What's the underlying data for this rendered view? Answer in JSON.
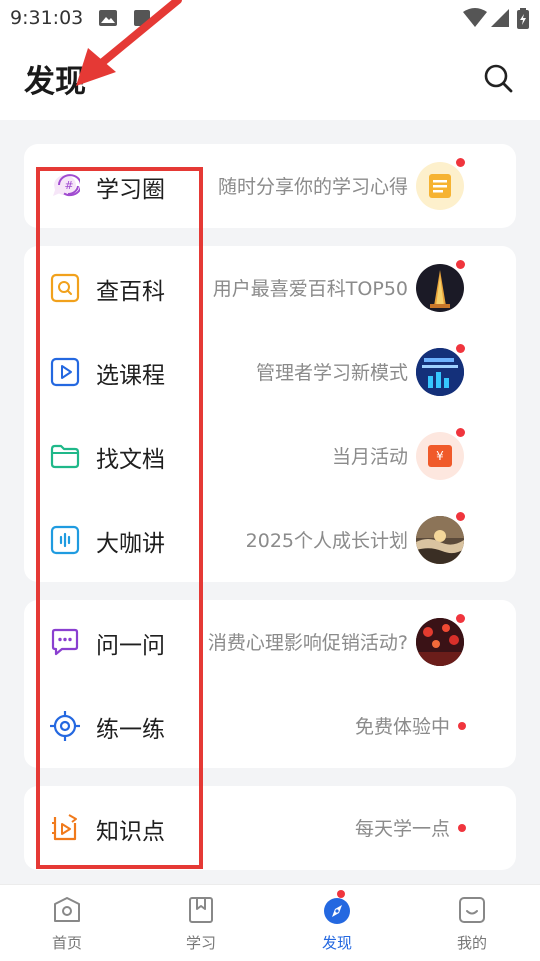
{
  "status_bar": {
    "time": "9:31:03"
  },
  "header": {
    "title": "发现"
  },
  "cards": [
    {
      "items": [
        {
          "label": "学习圈",
          "subtitle": "随时分享你的学习心得",
          "icon": "hashtag-chat-icon"
        }
      ]
    },
    {
      "items": [
        {
          "label": "查百科",
          "subtitle": "用户最喜爱百科TOP50",
          "icon": "search-box-icon"
        },
        {
          "label": "选课程",
          "subtitle": "管理者学习新模式",
          "icon": "play-box-icon"
        },
        {
          "label": "找文档",
          "subtitle": "当月活动",
          "icon": "folder-icon"
        },
        {
          "label": "大咖讲",
          "subtitle": "2025个人成长计划",
          "icon": "audio-wave-icon"
        }
      ]
    },
    {
      "items": [
        {
          "label": "问一问",
          "subtitle": "消费心理影响促销活动?",
          "icon": "chat-dots-icon"
        },
        {
          "label": "练一练",
          "subtitle": "免费体验中",
          "icon": "target-icon"
        }
      ]
    },
    {
      "items": [
        {
          "label": "知识点",
          "subtitle": "每天学一点",
          "icon": "video-note-icon"
        }
      ]
    }
  ],
  "tabbar": {
    "tabs": [
      {
        "label": "首页",
        "icon": "home-icon"
      },
      {
        "label": "学习",
        "icon": "bookmark-icon"
      },
      {
        "label": "发现",
        "icon": "compass-icon",
        "active": true
      },
      {
        "label": "我的",
        "icon": "profile-icon"
      }
    ]
  },
  "colors": {
    "accent": "#2468e0",
    "highlight_box": "#e53935",
    "badge": "#f0353d"
  }
}
